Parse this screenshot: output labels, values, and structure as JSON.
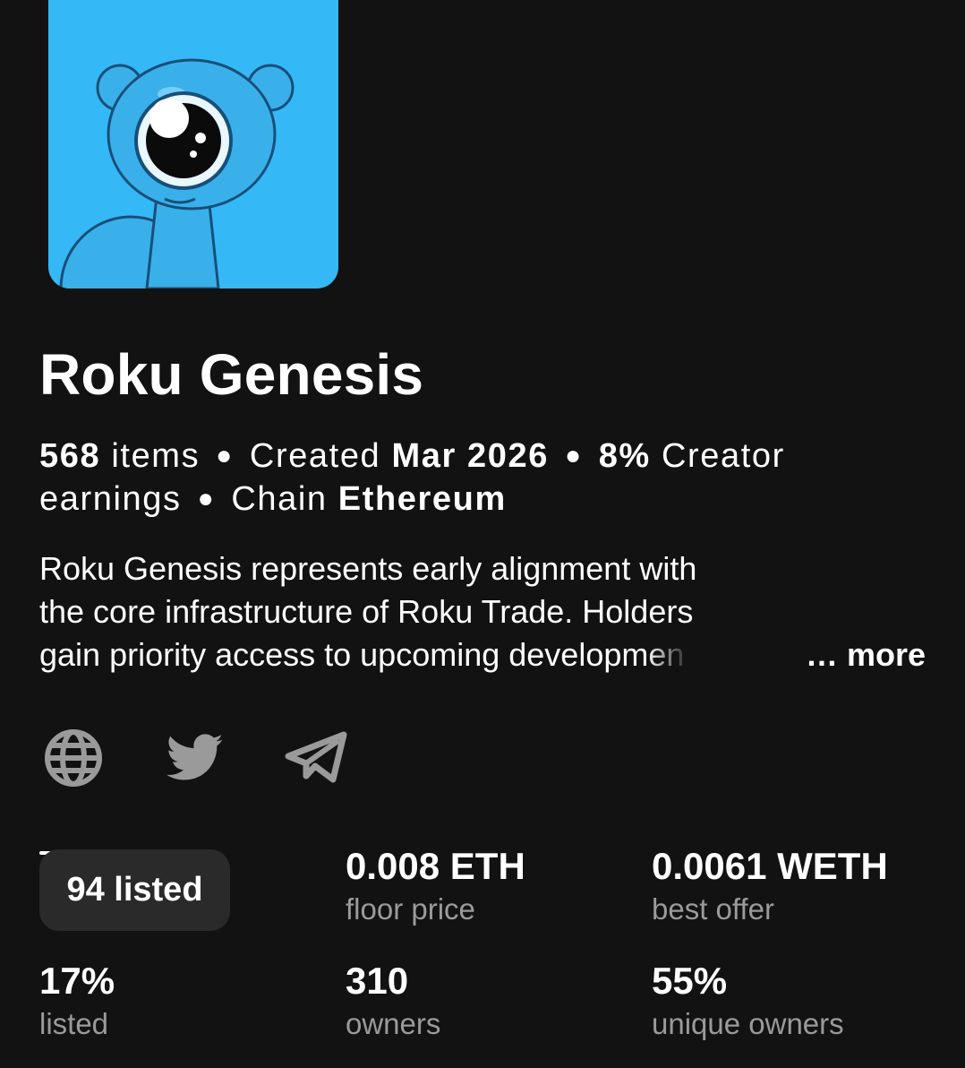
{
  "collection": {
    "name": "Roku Genesis",
    "image_icon": "cyclops-bear-avatar-icon",
    "accent_color": "#35b9f6",
    "meta": {
      "items_count": "568",
      "items_label": "items",
      "created_label": "Created",
      "created_value": "Mar 2026",
      "earnings_value": "8%",
      "earnings_label_line1": "Creator",
      "earnings_label_line2": "earnings",
      "chain_label": "Chain",
      "chain_value": "Ethereum"
    },
    "description": {
      "line1": "Roku Genesis represents early alignment with",
      "line2": "the core infrastructure of Roku Trade. Holders",
      "line3_start": "gain priority access to upcoming develop",
      "line3_faded": "men",
      "more_label": "… more"
    },
    "social_links": [
      {
        "icon": "globe-icon"
      },
      {
        "icon": "twitter-icon"
      },
      {
        "icon": "telegram-icon"
      }
    ]
  },
  "stats": {
    "tooltip": "94 listed",
    "floor_price": {
      "value": "0.008 ETH",
      "label": "floor price"
    },
    "best_offer": {
      "value": "0.0061 WETH",
      "label": "best offer"
    },
    "listed": {
      "value": "17%",
      "label": "listed"
    },
    "owners": {
      "value": "310",
      "label": "owners"
    },
    "unique_owners": {
      "value": "55%",
      "label": "unique owners"
    }
  }
}
